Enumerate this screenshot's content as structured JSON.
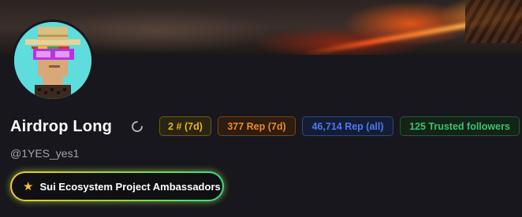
{
  "profile": {
    "name": "Airdrop Long",
    "handle": "@1YES_yes1"
  },
  "stats": {
    "rank": "2 # (7d)",
    "rep_7d": "377 Rep (7d)",
    "rep_all": "46,714 Rep (all)",
    "trusted_followers": "125 Trusted followers"
  },
  "badge": {
    "label": "Sui Ecosystem Project Ambassadors",
    "icon": "star-icon"
  },
  "colors": {
    "background": "#17171d",
    "avatar_bg": "#5fdcdc",
    "rank": "#e6b422",
    "rep_7d": "#f08a2c",
    "rep_all": "#4a7cf0",
    "trusted": "#3cc26a"
  }
}
